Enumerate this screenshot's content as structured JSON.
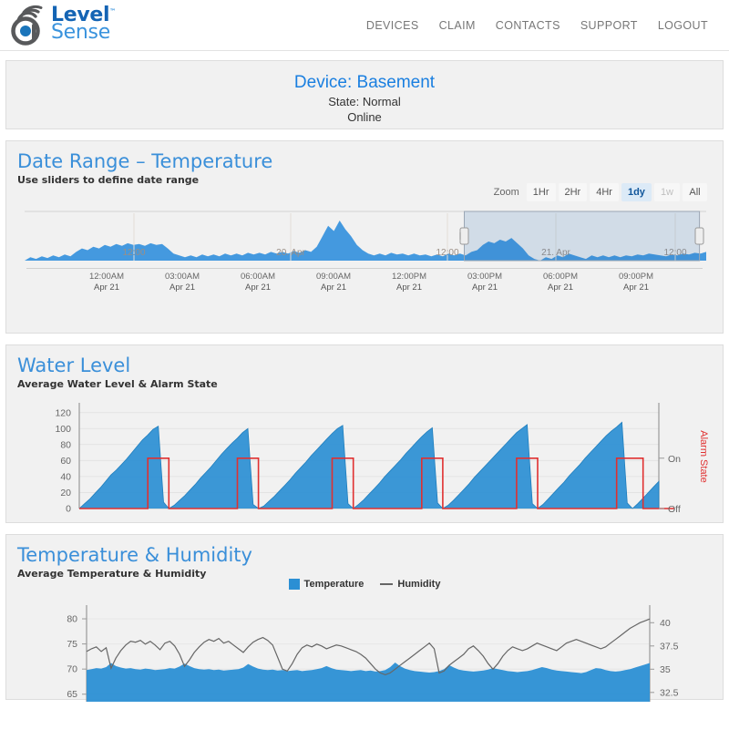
{
  "brand": {
    "name_line1": "Level",
    "name_line2": "Sense",
    "trademark": "™",
    "logo_icon": "wifi-drop-logo",
    "primary": "#1464b4",
    "secondary": "#3a93dd"
  },
  "nav": {
    "items": [
      {
        "label": "DEVICES",
        "name": "nav-devices"
      },
      {
        "label": "CLAIM",
        "name": "nav-claim"
      },
      {
        "label": "CONTACTS",
        "name": "nav-contacts"
      },
      {
        "label": "SUPPORT",
        "name": "nav-support"
      },
      {
        "label": "LOGOUT",
        "name": "nav-logout"
      }
    ]
  },
  "device": {
    "title": "Device: Basement",
    "state": "State: Normal",
    "connection": "Online"
  },
  "date_range": {
    "title": "Date Range – Temperature",
    "subtitle": "Use sliders to define date range",
    "zoom_label": "Zoom",
    "buttons": [
      {
        "label": "1Hr",
        "selected": false,
        "disabled": false
      },
      {
        "label": "2Hr",
        "selected": false,
        "disabled": false
      },
      {
        "label": "4Hr",
        "selected": false,
        "disabled": false
      },
      {
        "label": "1dy",
        "selected": true,
        "disabled": false
      },
      {
        "label": "1w",
        "selected": false,
        "disabled": true
      },
      {
        "label": "All",
        "selected": false,
        "disabled": false
      }
    ],
    "navigator_inline_labels": [
      "12:00",
      "20. Apr",
      "12:00",
      "21. Apr",
      "12:00"
    ],
    "axis_ticks": [
      {
        "time": "12:00AM",
        "date": "Apr 21"
      },
      {
        "time": "03:00AM",
        "date": "Apr 21"
      },
      {
        "time": "06:00AM",
        "date": "Apr 21"
      },
      {
        "time": "09:00AM",
        "date": "Apr 21"
      },
      {
        "time": "12:00PM",
        "date": "Apr 21"
      },
      {
        "time": "03:00PM",
        "date": "Apr 21"
      },
      {
        "time": "06:00PM",
        "date": "Apr 21"
      },
      {
        "time": "09:00PM",
        "date": "Apr 21"
      }
    ],
    "selection": {
      "start_pct": 64.5,
      "end_pct": 99.0
    }
  },
  "water_level": {
    "title": "Water Level",
    "subtitle": "Average Water Level & Alarm State",
    "y_left_ticks": [
      "0",
      "20",
      "40",
      "60",
      "80",
      "100",
      "120"
    ],
    "y_right_ticks": [
      "Off",
      "On"
    ],
    "right_axis_title": "Alarm State",
    "alarm_color": "#e03030",
    "level_color": "#2b8fd4"
  },
  "temp_humidity": {
    "title": "Temperature & Humidity",
    "subtitle": "Average Temperature & Humidity",
    "legend": [
      {
        "label": "Temperature",
        "marker": "box",
        "color": "#2b8fd4"
      },
      {
        "label": "Humidity",
        "marker": "line",
        "color": "#666666"
      }
    ],
    "y_left_ticks": [
      "65",
      "70",
      "75",
      "80"
    ],
    "y_right_ticks": [
      "32.5",
      "35",
      "37.5",
      "40"
    ]
  },
  "chart_data": [
    {
      "type": "area",
      "name": "date-range-navigator",
      "title": "Date Range – Temperature",
      "xlabel": "",
      "ylabel": "",
      "grid": false,
      "legend_position": "none",
      "x_tick_labels": [
        "12:00AM",
        "03:00AM",
        "06:00AM",
        "09:00AM",
        "12:00PM",
        "03:00PM",
        "06:00PM",
        "09:00PM"
      ],
      "x_tick_sublabels": [
        "Apr 21",
        "Apr 21",
        "Apr 21",
        "Apr 21",
        "Apr 21",
        "Apr 21",
        "Apr 21",
        "Apr 21"
      ],
      "inline_x_labels": [
        "12:00",
        "20. Apr",
        "12:00",
        "21. Apr",
        "12:00"
      ],
      "selection_window_pct": [
        64.5,
        99.0
      ],
      "series": [
        {
          "name": "Temperature",
          "color": "#3a93dd",
          "values": [
            52,
            56,
            54,
            57,
            55,
            58,
            56,
            59,
            57,
            62,
            66,
            64,
            68,
            66,
            70,
            68,
            71,
            69,
            72,
            70,
            71,
            69,
            72,
            70,
            71,
            66,
            60,
            58,
            56,
            58,
            56,
            59,
            57,
            59,
            57,
            60,
            58,
            60,
            58,
            61,
            59,
            61,
            59,
            62,
            60,
            62,
            60,
            63,
            61,
            64,
            62,
            68,
            80,
            92,
            86,
            98,
            88,
            80,
            70,
            64,
            60,
            58,
            60,
            58,
            61,
            59,
            60,
            58,
            60,
            58,
            59,
            57,
            59,
            57,
            60,
            58,
            60,
            58,
            62,
            64,
            70,
            74,
            72,
            76,
            74,
            78,
            72,
            66,
            58,
            54,
            52,
            56,
            54,
            58,
            56,
            60,
            58,
            56,
            54,
            58,
            56,
            58,
            56,
            58,
            56,
            58,
            57,
            59,
            58,
            60,
            59,
            58,
            57,
            59,
            58,
            60,
            59,
            61,
            60,
            62
          ]
        }
      ]
    },
    {
      "type": "area",
      "name": "water-level-chart",
      "title": "Water Level",
      "subtitle": "Average Water Level & Alarm State",
      "xlabel": "",
      "ylabel": "Water Level",
      "y2label": "Alarm State",
      "ylim": [
        0,
        130
      ],
      "y_ticks": [
        0,
        20,
        40,
        60,
        80,
        100,
        120
      ],
      "y2_ticks": [
        "Off",
        "On"
      ],
      "grid": true,
      "legend_position": "none",
      "series": [
        {
          "name": "Water Level",
          "color": "#2b8fd4",
          "type": "area",
          "values": [
            0,
            6,
            12,
            19,
            26,
            34,
            42,
            48,
            55,
            62,
            70,
            78,
            86,
            92,
            99,
            103,
            8,
            0,
            4,
            10,
            16,
            23,
            30,
            38,
            45,
            52,
            60,
            68,
            75,
            82,
            88,
            95,
            100,
            5,
            0,
            3,
            9,
            15,
            22,
            29,
            36,
            44,
            51,
            58,
            66,
            73,
            80,
            87,
            94,
            100,
            104,
            6,
            0,
            5,
            11,
            18,
            25,
            32,
            40,
            47,
            54,
            61,
            69,
            76,
            83,
            90,
            96,
            101,
            7,
            0,
            4,
            10,
            17,
            24,
            31,
            39,
            46,
            53,
            60,
            67,
            74,
            81,
            88,
            95,
            100,
            105,
            6,
            0,
            5,
            12,
            19,
            26,
            33,
            41,
            48,
            55,
            63,
            70,
            77,
            84,
            91,
            97,
            102,
            108,
            7,
            0,
            6,
            13,
            20,
            27,
            34
          ]
        },
        {
          "name": "Alarm State",
          "color": "#e03030",
          "type": "step",
          "values": [
            0,
            0,
            0,
            0,
            0,
            0,
            0,
            0,
            0,
            0,
            0,
            0,
            0,
            1,
            1,
            1,
            1,
            0,
            0,
            0,
            0,
            0,
            0,
            0,
            0,
            0,
            0,
            0,
            0,
            0,
            1,
            1,
            1,
            1,
            0,
            0,
            0,
            0,
            0,
            0,
            0,
            0,
            0,
            0,
            0,
            0,
            0,
            0,
            1,
            1,
            1,
            1,
            0,
            0,
            0,
            0,
            0,
            0,
            0,
            0,
            0,
            0,
            0,
            0,
            0,
            1,
            1,
            1,
            1,
            0,
            0,
            0,
            0,
            0,
            0,
            0,
            0,
            0,
            0,
            0,
            0,
            0,
            0,
            1,
            1,
            1,
            1,
            0,
            0,
            0,
            0,
            0,
            0,
            0,
            0,
            0,
            0,
            0,
            0,
            0,
            0,
            0,
            1,
            1,
            1,
            1,
            1,
            0,
            0,
            0,
            0,
            0,
            0,
            0
          ],
          "on_value_level": 63
        }
      ]
    },
    {
      "type": "line",
      "name": "temperature-humidity-chart",
      "title": "Temperature & Humidity",
      "subtitle": "Average Temperature & Humidity",
      "xlabel": "",
      "ylabel": "Temperature",
      "y2label": "Humidity",
      "ylim": [
        63.5,
        82
      ],
      "y_ticks": [
        65,
        70,
        75,
        80
      ],
      "y2lim": [
        31.5,
        41.5
      ],
      "y2_ticks": [
        32.5,
        35,
        37.5,
        40
      ],
      "grid": true,
      "legend_position": "top-center",
      "series": [
        {
          "name": "Temperature",
          "color": "#2b8fd4",
          "type": "area",
          "axis": "left",
          "values": [
            69.8,
            70.0,
            70.2,
            70.1,
            70.4,
            71.2,
            70.6,
            70.3,
            70.1,
            70.2,
            70.0,
            69.9,
            70.1,
            70.0,
            69.8,
            69.9,
            70.0,
            70.2,
            70.1,
            70.5,
            71.1,
            70.6,
            70.2,
            70.0,
            69.9,
            70.0,
            69.8,
            69.9,
            69.7,
            69.8,
            69.9,
            70.0,
            70.3,
            71.0,
            70.5,
            70.1,
            69.9,
            69.8,
            69.9,
            69.7,
            69.8,
            69.6,
            69.7,
            69.8,
            69.6,
            69.7,
            69.8,
            70.0,
            70.2,
            70.6,
            70.2,
            69.9,
            69.8,
            69.7,
            69.6,
            69.7,
            69.8,
            69.6,
            69.7,
            69.5,
            69.6,
            69.8,
            70.4,
            71.3,
            70.6,
            70.1,
            69.8,
            69.6,
            69.5,
            69.4,
            69.3,
            69.4,
            69.6,
            70.0,
            70.8,
            70.3,
            69.9,
            69.7,
            69.6,
            69.5,
            69.6,
            69.7,
            69.9,
            70.2,
            70.0,
            69.8,
            69.6,
            69.5,
            69.4,
            69.5,
            69.6,
            69.8,
            70.1,
            70.4,
            70.2,
            69.9,
            69.7,
            69.6,
            69.5,
            69.4,
            69.3,
            69.2,
            69.4,
            69.8,
            70.2,
            70.1,
            69.8,
            69.6,
            69.5,
            69.6,
            69.8,
            70.0,
            70.3,
            70.6,
            70.9,
            71.2
          ]
        },
        {
          "name": "Humidity",
          "color": "#666666",
          "type": "line",
          "axis": "right",
          "values": [
            36.9,
            37.2,
            37.4,
            36.9,
            37.3,
            35.1,
            36.2,
            37.0,
            37.6,
            38.0,
            37.9,
            38.1,
            37.7,
            38.0,
            37.6,
            37.1,
            37.8,
            38.0,
            37.5,
            36.6,
            35.3,
            36.0,
            36.8,
            37.4,
            37.9,
            38.2,
            38.0,
            38.3,
            37.8,
            38.0,
            37.6,
            37.2,
            36.8,
            37.4,
            37.9,
            38.2,
            38.4,
            38.1,
            37.6,
            36.3,
            35.0,
            34.8,
            35.6,
            36.6,
            37.3,
            37.6,
            37.4,
            37.7,
            37.5,
            37.2,
            37.4,
            37.6,
            37.5,
            37.3,
            37.1,
            36.9,
            36.6,
            36.2,
            35.6,
            35.0,
            34.6,
            34.4,
            34.6,
            35.0,
            35.4,
            35.8,
            36.2,
            36.6,
            37.0,
            37.4,
            37.8,
            37.2,
            34.6,
            34.8,
            35.4,
            35.8,
            36.2,
            36.6,
            37.2,
            37.5,
            37.0,
            36.4,
            35.6,
            35.0,
            35.6,
            36.4,
            37.0,
            37.4,
            37.2,
            37.0,
            37.2,
            37.5,
            37.8,
            37.6,
            37.4,
            37.2,
            37.0,
            37.4,
            37.8,
            38.0,
            38.2,
            38.0,
            37.8,
            37.6,
            37.4,
            37.2,
            37.4,
            37.8,
            38.2,
            38.6,
            39.0,
            39.4,
            39.7,
            40.0,
            40.2,
            40.4
          ]
        }
      ]
    }
  ]
}
